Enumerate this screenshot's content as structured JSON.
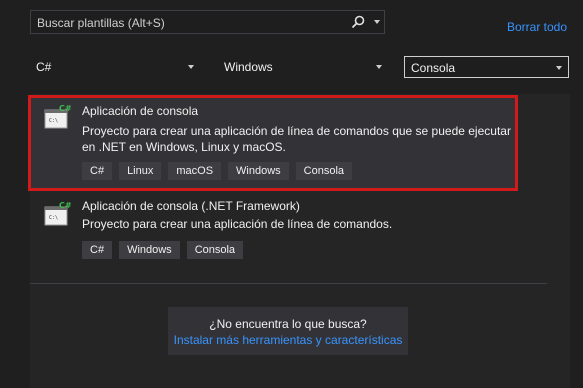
{
  "search": {
    "placeholder": "Buscar plantillas (Alt+S)"
  },
  "clear_all": "Borrar todo",
  "filters": {
    "language": "C#",
    "platform": "Windows",
    "project_type": "Consola"
  },
  "templates": [
    {
      "title": "Aplicación de consola",
      "description_line1": "Proyecto para crear una aplicación de línea de comandos que se puede ejecutar",
      "description_line2": "en .NET en Windows, Linux y macOS.",
      "tags": [
        "C#",
        "Linux",
        "macOS",
        "Windows",
        "Consola"
      ],
      "selected": true
    },
    {
      "title": "Aplicación de consola (.NET Framework)",
      "description_line1": "Proyecto para crear una aplicación de línea de comandos.",
      "tags": [
        "C#",
        "Windows",
        "Consola"
      ],
      "selected": false
    }
  ],
  "help": {
    "question": "¿No encuentra lo que busca?",
    "link": "Instalar más herramientas y características"
  },
  "colors": {
    "accent_link": "#3794ff",
    "highlight_border": "#d11a1a",
    "icon_badge": "#3fb950"
  },
  "icons": {
    "search": "search-icon",
    "template": "console-template-icon"
  }
}
